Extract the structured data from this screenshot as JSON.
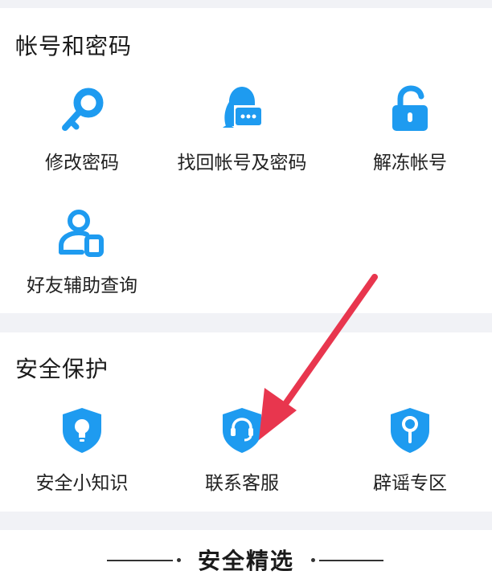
{
  "account_section": {
    "title": "帐号和密码",
    "items": [
      {
        "label": "修改密码",
        "icon": "key-icon"
      },
      {
        "label": "找回帐号及密码",
        "icon": "penguin-chat-icon"
      },
      {
        "label": "解冻帐号",
        "icon": "unlock-icon"
      },
      {
        "label": "好友辅助查询",
        "icon": "friend-assist-icon"
      }
    ]
  },
  "security_section": {
    "title": "安全保护",
    "items": [
      {
        "label": "安全小知识",
        "icon": "lightbulb-shield-icon"
      },
      {
        "label": "联系客服",
        "icon": "headset-shield-icon"
      },
      {
        "label": "辟谣专区",
        "icon": "search-shield-icon"
      }
    ]
  },
  "featured_section": {
    "title": "安全精选"
  },
  "colors": {
    "accent": "#1e9bf0",
    "annotation_arrow": "#e8364e",
    "background": "#f1f2f6"
  }
}
